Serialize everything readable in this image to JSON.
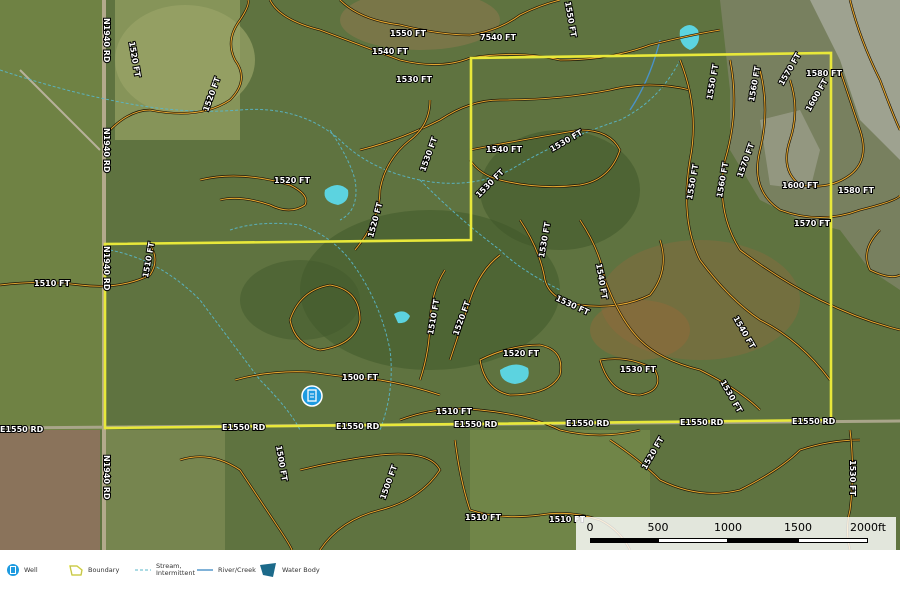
{
  "legend": {
    "well": "Well",
    "boundary": "Boundary",
    "stream": "Stream,\nIntermittent",
    "river": "River/Creek",
    "water_body": "Water Body"
  },
  "scale": {
    "ticks": [
      "0",
      "500",
      "1000",
      "1500",
      "2000ft"
    ]
  },
  "roads": {
    "n1940_top": "N1940 RD",
    "n1940_mid": "N1940 RD",
    "n1940_left": "N1940 RD",
    "n1940_bottom": "N1940 RD",
    "e1550_left": "E1550 RD",
    "e1550_a": "E1550 RD",
    "e1550_b": "E1550 RD",
    "e1550_c": "E1550 RD",
    "e1550_d": "E1550 RD",
    "e1550_e": "E1550 RD",
    "e1550_f": "E1550 RD",
    "e1550_g": "E1550 RD"
  },
  "contours": {
    "c1550_top": "1550 FT",
    "c1540_top": "1540 FT",
    "c7540": "7540 FT",
    "c1550_a": "1550 FT",
    "c1530_a": "1530 FT",
    "c1520_a": "1520 FT",
    "c1520_b": "1520 FT",
    "c1520_c": "1520 FT",
    "c1530_b": "1530 FT",
    "c1520_d": "1520 FT",
    "c1540_a": "1540 FT",
    "c1530_c": "1530 FT",
    "c1530_d": "1530 FT",
    "c1550_b": "1550 FT",
    "c1560_a": "1560 FT",
    "c1570_a": "1570 FT",
    "c1580_a": "1580 FT",
    "c1600_a": "1600 FT",
    "c1600_b": "1600 FT",
    "c1580_b": "1580 FT",
    "c1570_b": "1570 FT",
    "c1550_c": "1550 FT",
    "c1560_b": "1560 FT",
    "c1570_c": "1570 FT",
    "c1510_a": "1510 FT",
    "c1510_b": "1510 FT",
    "c1530_e": "1530 FT",
    "c1540_b": "1540 FT",
    "c1530_f": "1530 FT",
    "c1510_c": "1510 FT",
    "c1520_e": "1520 FT",
    "c1520_f": "1520 FT",
    "c1530_g": "1530 FT",
    "c1540_c": "1540 FT",
    "c1530_h": "1530 FT",
    "c1500_a": "1500 FT",
    "c1510_d": "1510 FT",
    "c1500_b": "1500 FT",
    "c1510_e": "1510 FT",
    "c1500_c": "1500 FT",
    "c1520_g": "1520 FT",
    "c1510_f": "1510 FT",
    "c1510_g": "1510 FT",
    "c1530_i": "1530 FT",
    "c1520_h": "1520 FT"
  },
  "colors": {
    "boundary": "#e8e83a",
    "water": "#5cd3e0",
    "well": "#1e9be0",
    "contour": "#e1a530"
  }
}
